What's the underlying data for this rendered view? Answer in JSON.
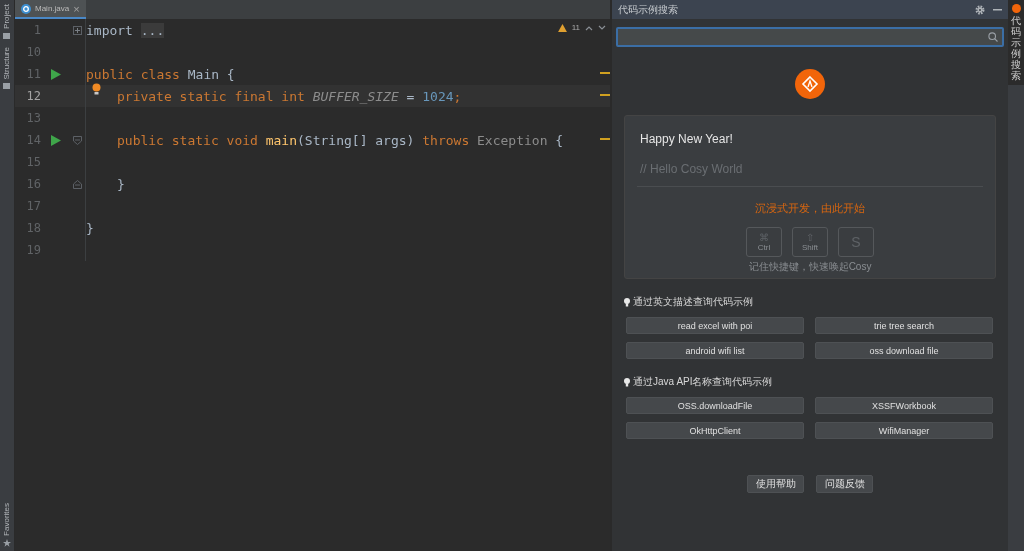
{
  "left_strip": {
    "top": [
      {
        "label": "Project"
      },
      {
        "label": "Structure"
      }
    ],
    "bottom": [
      {
        "label": "Favorites"
      }
    ]
  },
  "editor": {
    "tabs": [
      {
        "label": "Main.java",
        "selected": true,
        "close": "×"
      }
    ],
    "warnings": {
      "count": "11"
    },
    "lines": [
      {
        "number": "1",
        "kind": "fold-collapsed",
        "run": false,
        "current": false,
        "bulb": false,
        "indent": false,
        "tokens": [
          {
            "kind": "plain",
            "text": "import "
          },
          {
            "kind": "folded",
            "text": "..."
          }
        ]
      },
      {
        "number": "10",
        "kind": "plain",
        "run": false,
        "current": false,
        "bulb": false
      },
      {
        "number": "11",
        "kind": "plain",
        "run": true,
        "current": false,
        "bulb": false,
        "indent": false,
        "tokens": [
          {
            "kind": "keyword",
            "text": "public class "
          },
          {
            "kind": "plain",
            "text": "Main {"
          }
        ]
      },
      {
        "number": "12",
        "kind": "plain",
        "run": false,
        "current": true,
        "bulb": true,
        "indent": true,
        "tokens": [
          {
            "kind": "keyword",
            "text": "private static final int "
          },
          {
            "kind": "constant",
            "text": "BUFFER_SIZE"
          },
          {
            "kind": "plain",
            "text": " = "
          },
          {
            "kind": "number",
            "text": "1024"
          },
          {
            "kind": "keyword",
            "text": ";"
          }
        ]
      },
      {
        "number": "13",
        "kind": "plain",
        "run": false,
        "current": false,
        "bulb": false
      },
      {
        "number": "14",
        "kind": "fold-start",
        "run": true,
        "current": false,
        "bulb": false,
        "indent": true,
        "tokens": [
          {
            "kind": "keyword",
            "text": "public static void "
          },
          {
            "kind": "function",
            "text": "main"
          },
          {
            "kind": "plain",
            "text": "(String[] args) "
          },
          {
            "kind": "keyword",
            "text": "throws "
          },
          {
            "kind": "muted",
            "text": "Exception"
          },
          {
            "kind": "plain",
            "text": " {"
          }
        ]
      },
      {
        "number": "15",
        "kind": "plain",
        "run": false,
        "current": false,
        "bulb": false
      },
      {
        "number": "16",
        "kind": "fold-end",
        "run": false,
        "current": false,
        "bulb": false,
        "indent": true,
        "tokens": [
          {
            "kind": "plain",
            "text": "}"
          }
        ]
      },
      {
        "number": "17",
        "kind": "plain",
        "run": false,
        "current": false,
        "bulb": false
      },
      {
        "number": "18",
        "kind": "plain",
        "run": false,
        "current": false,
        "bulb": false,
        "indent": false,
        "tokens": [
          {
            "kind": "plain",
            "text": "}"
          }
        ]
      },
      {
        "number": "19",
        "kind": "plain",
        "run": false,
        "current": false,
        "bulb": false
      }
    ]
  },
  "panel": {
    "title": "代码示例搜索",
    "card": {
      "greeting": "Happy New Year!",
      "comment": "// Hello Cosy World",
      "slogan": "沉浸式开发，由此开始",
      "keys": [
        {
          "symbol": "⌘",
          "label": "Ctrl"
        },
        {
          "symbol": "⇧",
          "label": "Shift"
        },
        {
          "symbol": "S"
        }
      ],
      "hint": "记住快捷键，快速唤起Cosy"
    },
    "sections": [
      {
        "title": "通过英文描述查询代码示例",
        "buttons": [
          "read excel with poi",
          "trie tree search",
          "android wifi list",
          "oss download file"
        ]
      },
      {
        "title": "通过Java API名称查询代码示例",
        "buttons": [
          "OSS.downloadFile",
          "XSSFWorkbook",
          "OkHttpClient",
          "WifiManager"
        ]
      }
    ],
    "footer_buttons": [
      "使用帮助",
      "问题反馈"
    ]
  },
  "right_strip": {
    "label": "代码示例搜索"
  }
}
